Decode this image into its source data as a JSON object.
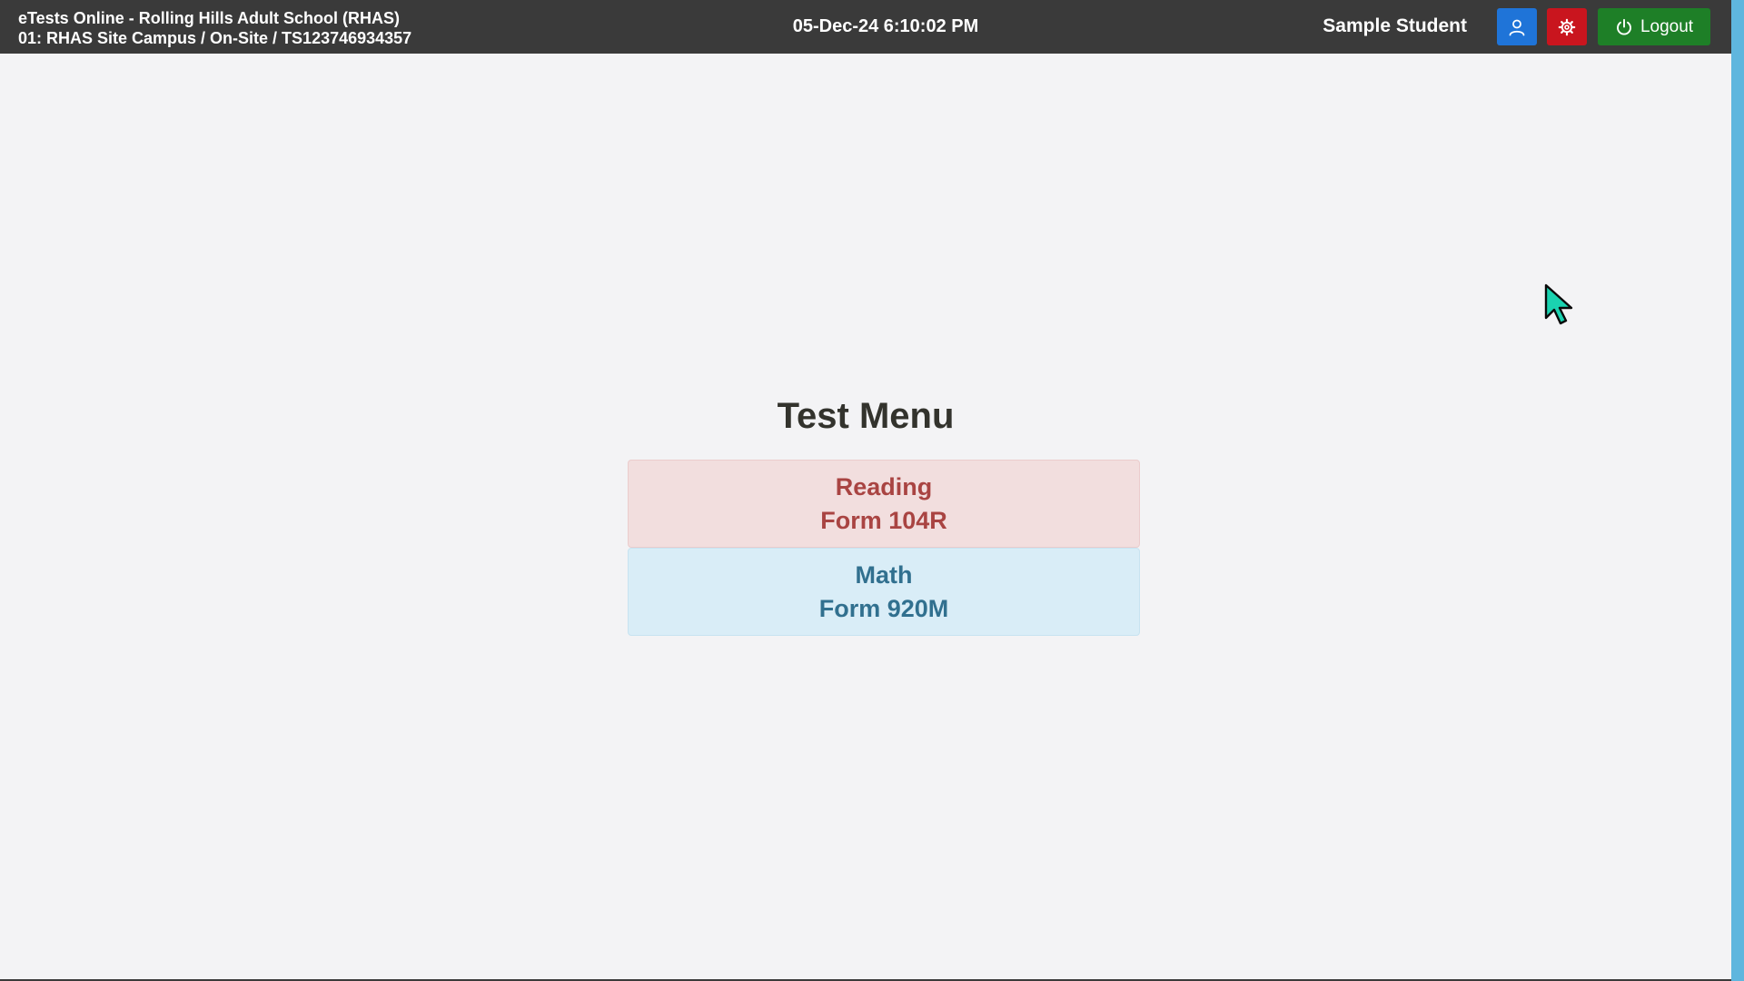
{
  "header": {
    "app_line1": "eTests Online - Rolling Hills Adult School (RHAS)",
    "app_line2": "01: RHAS Site Campus / On-Site / TS123746934357",
    "datetime": "05-Dec-24 6:10:02 PM",
    "user_name": "Sample Student",
    "logout_label": "Logout",
    "colors": {
      "bar": "#3a3a3a",
      "user_button": "#1f74d8",
      "settings_button": "#c9151e",
      "logout_button": "#1e7f27"
    },
    "icons": {
      "user": "user-icon",
      "settings": "gear-icon",
      "logout": "power-icon"
    }
  },
  "main": {
    "title": "Test Menu",
    "tests": [
      {
        "subject": "Reading",
        "form": "Form 104R",
        "bg_color": "#f2dede",
        "text_color": "#a94442"
      },
      {
        "subject": "Math",
        "form": "Form 920M",
        "bg_color": "#d9edf7",
        "text_color": "#31708f"
      }
    ]
  }
}
